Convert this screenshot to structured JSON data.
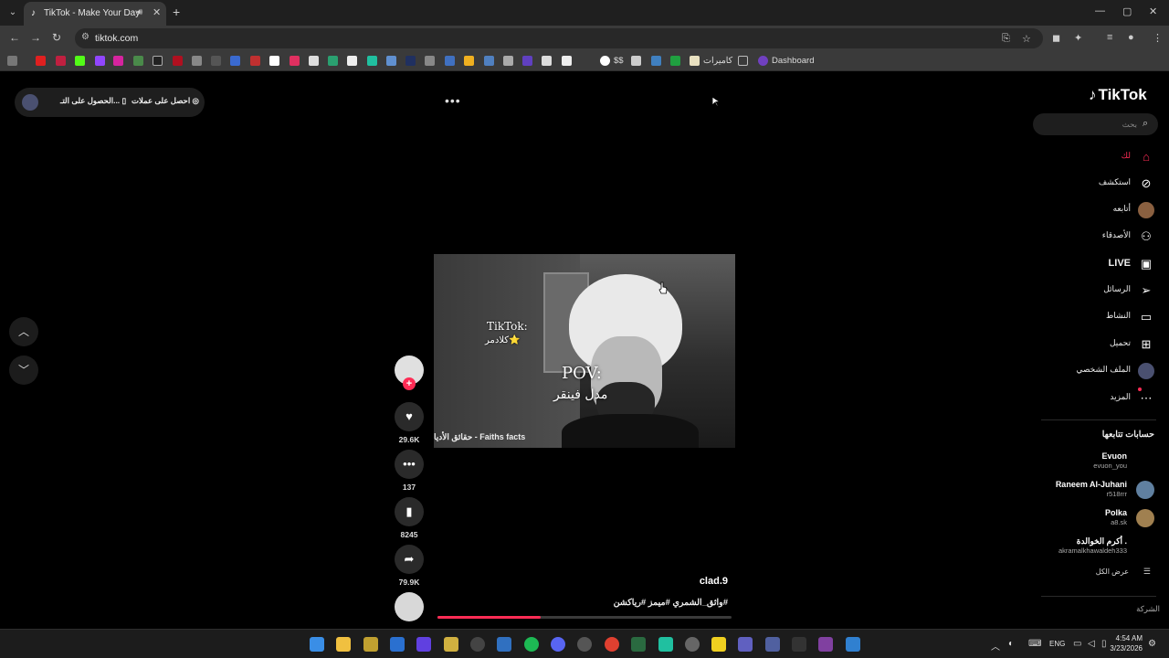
{
  "browser": {
    "tab_title": "TikTok - Make Your Day",
    "url": "tiktok.com",
    "bookmarks": {
      "cameras_label": "كاميرات",
      "gs_label": "$$",
      "folder_label": "",
      "dashboard_label": "Dashboard"
    }
  },
  "page": {
    "top_pill": {
      "get_coins_label": "احصل على عملات",
      "get_app_label": "الحصول على التـ..."
    },
    "video": {
      "overlay_tiktok": "TikTok:",
      "overlay_handle": "كلادمر⭐",
      "overlay_pov": "POV:",
      "overlay_arabic": "مدل فينقر",
      "watermark": "حقائق الأديا - Faiths facts",
      "progress_fraction": 0.35
    },
    "actions": {
      "likes": "29.6K",
      "comments": "137",
      "saves": "8245",
      "shares": "79.9K"
    },
    "caption": {
      "author": "clad.9",
      "tags": "#واثق_الشمري #ميمز #رياكشن"
    }
  },
  "sidebar": {
    "logo": "TikTok",
    "search_placeholder": "بحث",
    "nav": [
      {
        "label": "لك",
        "icon": "home-icon"
      },
      {
        "label": "استكشف",
        "icon": "compass-icon"
      },
      {
        "label": "أتابعه",
        "icon": "avatar"
      },
      {
        "label": "الأصدقاء",
        "icon": "friends-icon"
      },
      {
        "label": "LIVE",
        "icon": "live-icon"
      },
      {
        "label": "الرسائل",
        "icon": "send-icon"
      },
      {
        "label": "النشاط",
        "icon": "message-icon"
      },
      {
        "label": "تحميل",
        "icon": "upload-icon"
      },
      {
        "label": "الملف الشخصي",
        "icon": "avatar"
      },
      {
        "label": "المزيد",
        "icon": "more-icon"
      }
    ],
    "following_title": "حسابات تتابعها",
    "accounts": [
      {
        "name": "Evuon",
        "handle": "evuon_you"
      },
      {
        "name": "Raneem Al-Juhani",
        "handle": "r518rrr"
      },
      {
        "name": "Polka",
        "handle": "a8.sk"
      },
      {
        "name": "أكرم الخوالدة .",
        "handle": "akramalkhawaldeh333"
      }
    ],
    "see_all": "عرض الكل",
    "company": "الشركة"
  },
  "taskbar": {
    "language": "ENG",
    "time": "4:54 AM",
    "date": "3/23/2026"
  },
  "colors": {
    "accent": "#fe2c55",
    "background": "#000000"
  }
}
